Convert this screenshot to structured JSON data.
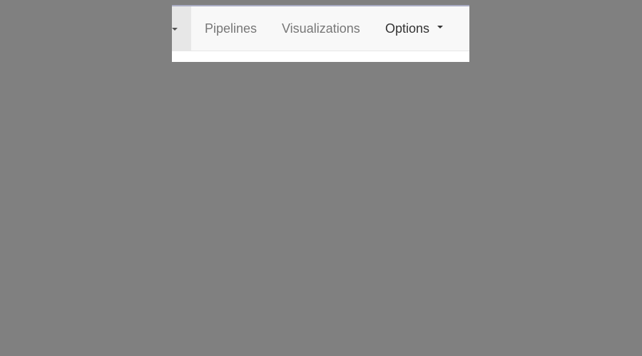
{
  "navbar": {
    "active_dropdown_icon": "caret-down-icon",
    "items": [
      {
        "label": "Pipelines"
      },
      {
        "label": "Visualizations"
      },
      {
        "label": "Options",
        "icon": "caret-down-icon"
      }
    ]
  },
  "colors": {
    "background_overlay": "#808080",
    "navbar_bg": "#f8f8f8",
    "active_cell_bg": "#e7e7e7",
    "nav_text": "#777777",
    "nav_text_dark": "#333333",
    "window_top_border": "#a9acc4"
  }
}
